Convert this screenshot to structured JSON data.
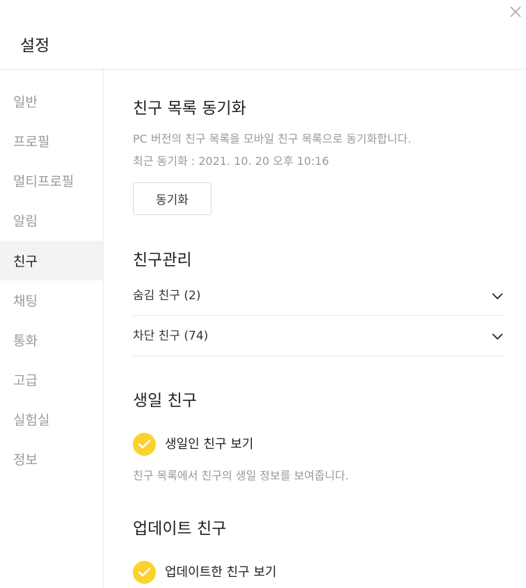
{
  "window": {
    "title": "설정",
    "close_icon": "close-icon"
  },
  "sidebar": {
    "items": [
      {
        "label": "일반",
        "active": false
      },
      {
        "label": "프로필",
        "active": false
      },
      {
        "label": "멀티프로필",
        "active": false
      },
      {
        "label": "알림",
        "active": false
      },
      {
        "label": "친구",
        "active": true
      },
      {
        "label": "채팅",
        "active": false
      },
      {
        "label": "통화",
        "active": false
      },
      {
        "label": "고급",
        "active": false
      },
      {
        "label": "실험실",
        "active": false
      },
      {
        "label": "정보",
        "active": false
      }
    ]
  },
  "sync": {
    "title": "친구 목록 동기화",
    "description": "PC 버전의 친구 목록을 모바일 친구 목록으로 동기화합니다.",
    "last_sync": "최근 동기화 : 2021. 10. 20 오후 10:16",
    "button_label": "동기화"
  },
  "manage": {
    "title": "친구관리",
    "hidden_friends": "숨김 친구 (2)",
    "blocked_friends": "차단 친구 (74)"
  },
  "birthday": {
    "title": "생일 친구",
    "checkbox_label": "생일인 친구 보기",
    "checked": true,
    "description": "친구 목록에서 친구의 생일 정보를 보여줍니다."
  },
  "updated": {
    "title": "업데이트 친구",
    "checkbox_label": "업데이트한 친구 보기",
    "checked": true
  },
  "colors": {
    "accent_yellow": "#fbd12d",
    "active_nav_bg": "#f3f3f3",
    "muted_text": "#999999"
  }
}
